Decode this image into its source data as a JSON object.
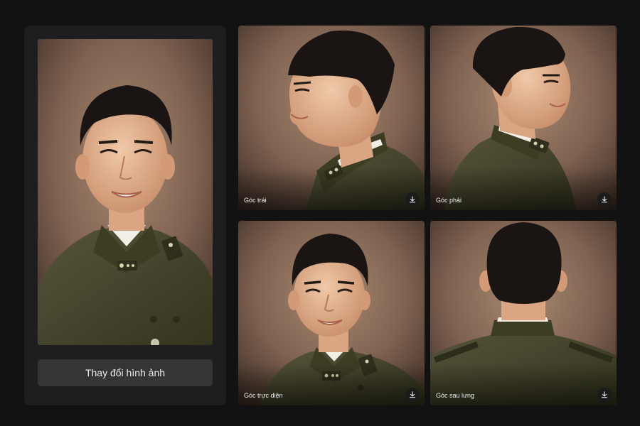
{
  "main_panel": {
    "change_button_label": "Thay đổi hình ảnh"
  },
  "gallery": {
    "tiles": [
      {
        "caption": "Góc trái",
        "view": "left-profile"
      },
      {
        "caption": "Góc phải",
        "view": "right-profile"
      },
      {
        "caption": "Góc trực diện",
        "view": "front"
      },
      {
        "caption": "Góc sau lưng",
        "view": "back"
      }
    ]
  },
  "colors": {
    "page_background": "#121213",
    "panel_background": "#1e1e20",
    "button_background": "#353538",
    "uniform_olive": "#4a4a2a",
    "studio_backdrop": "#8a6a52"
  },
  "icons": {
    "download": "download-icon"
  }
}
